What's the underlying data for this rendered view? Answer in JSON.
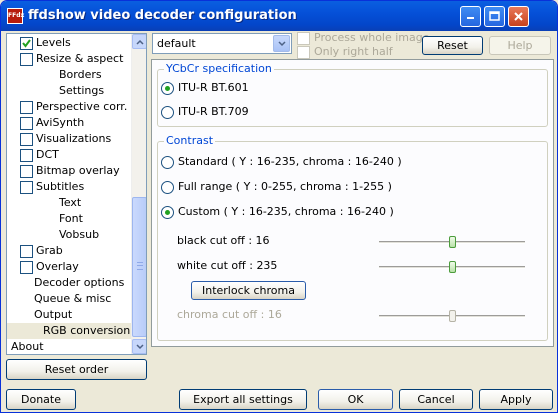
{
  "window": {
    "title": "ffdshow video decoder configuration",
    "icon_text": "FFdx"
  },
  "sidebar": {
    "items": [
      {
        "label": "Levels",
        "checkbox": true,
        "checked": true,
        "indent": 0
      },
      {
        "label": "Resize & aspect",
        "checkbox": true,
        "checked": false,
        "indent": 0
      },
      {
        "label": "Borders",
        "checkbox": false,
        "indent": 1
      },
      {
        "label": "Settings",
        "checkbox": false,
        "indent": 1
      },
      {
        "label": "Perspective corr.",
        "checkbox": true,
        "checked": false,
        "indent": 0
      },
      {
        "label": "AviSynth",
        "checkbox": true,
        "checked": false,
        "indent": 0
      },
      {
        "label": "Visualizations",
        "checkbox": true,
        "checked": false,
        "indent": 0
      },
      {
        "label": "DCT",
        "checkbox": true,
        "checked": false,
        "indent": 0
      },
      {
        "label": "Bitmap overlay",
        "checkbox": true,
        "checked": false,
        "indent": 0
      },
      {
        "label": "Subtitles",
        "checkbox": true,
        "checked": false,
        "indent": 0
      },
      {
        "label": "Text",
        "checkbox": false,
        "indent": 1
      },
      {
        "label": "Font",
        "checkbox": false,
        "indent": 1
      },
      {
        "label": "Vobsub",
        "checkbox": false,
        "indent": 1
      },
      {
        "label": "Grab",
        "checkbox": true,
        "checked": false,
        "indent": 0
      },
      {
        "label": "Overlay",
        "checkbox": true,
        "checked": false,
        "indent": 0
      },
      {
        "label": "Decoder options",
        "checkbox": false,
        "indent": 2
      },
      {
        "label": "Queue & misc",
        "checkbox": false,
        "indent": 2
      },
      {
        "label": "Output",
        "checkbox": false,
        "indent": 2
      },
      {
        "label": "RGB conversion",
        "checkbox": false,
        "indent": 3,
        "selected": true
      },
      {
        "label": "About",
        "checkbox": false,
        "indent": -1
      }
    ],
    "reset_order_label": "Reset order"
  },
  "top": {
    "preset_value": "default",
    "process_whole_image": "Process whole image",
    "only_right_half": "Only right half",
    "reset_label": "Reset",
    "help_label": "Help"
  },
  "ycbcr": {
    "title": "YCbCr specification",
    "options": [
      "ITU-R BT.601",
      "ITU-R BT.709"
    ],
    "selected": 0
  },
  "contrast": {
    "title": "Contrast",
    "options": [
      "Standard ( Y : 16-235, chroma : 16-240 )",
      "Full range ( Y : 0-255, chroma : 1-255 )",
      "Custom ( Y : 16-235, chroma : 16-240 )"
    ],
    "selected": 2,
    "black_cutoff_label": "black cut off : 16",
    "black_cutoff_value": 16,
    "white_cutoff_label": "white cut off : 235",
    "white_cutoff_value": 235,
    "interlock_label": "Interlock chroma",
    "chroma_cutoff_label": "chroma cut off : 16",
    "chroma_cutoff_value": 16
  },
  "bottom": {
    "donate": "Donate",
    "export": "Export all settings",
    "ok": "OK",
    "cancel": "Cancel",
    "apply": "Apply"
  }
}
